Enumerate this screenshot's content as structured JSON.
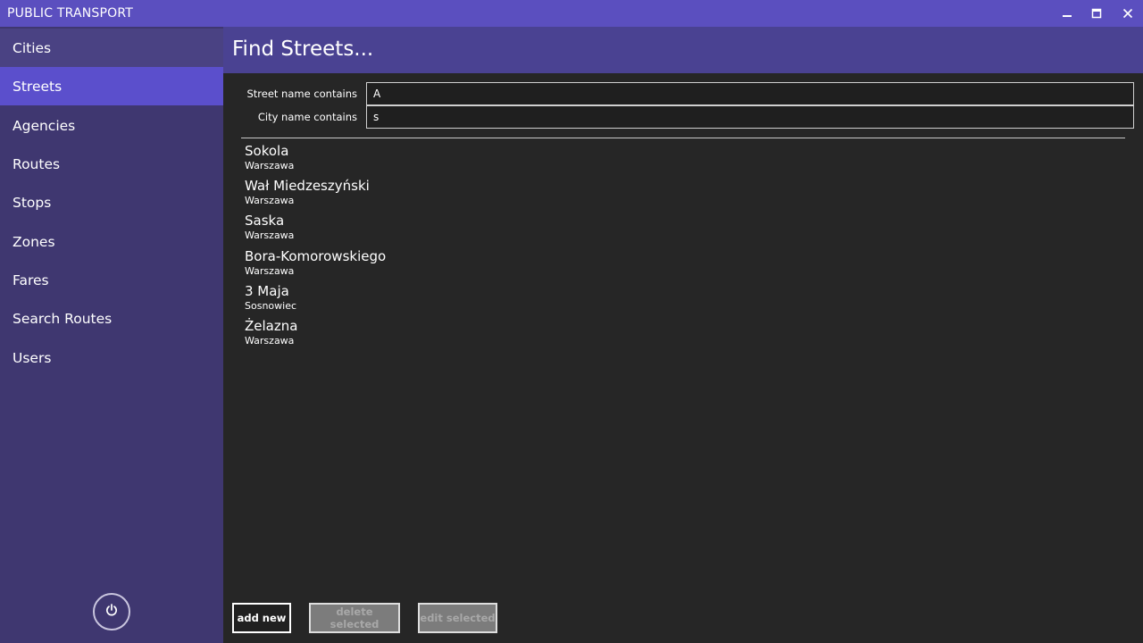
{
  "app": {
    "title": "PUBLIC TRANSPORT"
  },
  "window_controls": {
    "minimize_icon": "minimize-icon",
    "maximize_icon": "maximize-icon",
    "close_icon": "close-icon"
  },
  "sidebar": {
    "items": [
      {
        "label": "Cities",
        "state": "hover"
      },
      {
        "label": "Streets",
        "state": "selected"
      },
      {
        "label": "Agencies",
        "state": "normal"
      },
      {
        "label": "Routes",
        "state": "normal"
      },
      {
        "label": "Stops",
        "state": "normal"
      },
      {
        "label": "Zones",
        "state": "normal"
      },
      {
        "label": "Fares",
        "state": "normal"
      },
      {
        "label": "Search Routes",
        "state": "normal"
      },
      {
        "label": "Users",
        "state": "normal"
      }
    ],
    "power_icon": "power-icon"
  },
  "header": {
    "title": "Find Streets..."
  },
  "filters": {
    "street": {
      "label": "Street name contains",
      "value": "A"
    },
    "city": {
      "label": "City name contains",
      "value": "s"
    }
  },
  "results": [
    {
      "street": "Sokola",
      "city": "Warszawa"
    },
    {
      "street": "Wał Miedzeszyński",
      "city": "Warszawa"
    },
    {
      "street": "Saska",
      "city": "Warszawa"
    },
    {
      "street": "Bora-Komorowskiego",
      "city": "Warszawa"
    },
    {
      "street": "3 Maja",
      "city": "Sosnowiec"
    },
    {
      "street": "Żelazna",
      "city": "Warszawa"
    }
  ],
  "actions": {
    "add_label": "add new",
    "delete_label": "delete selected",
    "edit_label": "edit selected"
  },
  "colors": {
    "titlebar": "#5b4fbf",
    "sidebar": "#3f3770",
    "sidebar_selected": "#5b4fcc",
    "header": "#4a4292",
    "content_bg": "#262626"
  }
}
